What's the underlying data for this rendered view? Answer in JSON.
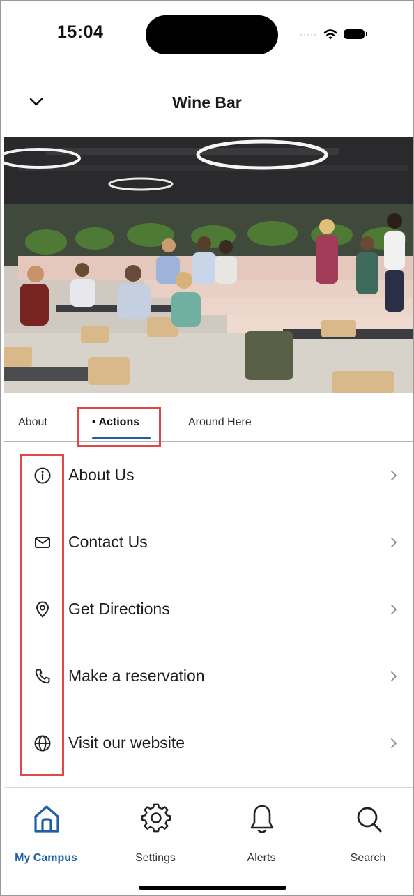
{
  "status_bar": {
    "time": "15:04"
  },
  "header": {
    "title": "Wine Bar"
  },
  "tabs": [
    {
      "label": "About"
    },
    {
      "label": "• Actions"
    },
    {
      "label": "Around Here"
    }
  ],
  "actions": [
    {
      "label": "About Us",
      "icon": "info-icon"
    },
    {
      "label": "Contact Us",
      "icon": "mail-icon"
    },
    {
      "label": "Get Directions",
      "icon": "location-pin-icon"
    },
    {
      "label": "Make a reservation",
      "icon": "phone-icon"
    },
    {
      "label": "Visit our website",
      "icon": "globe-icon"
    }
  ],
  "bottom_nav": [
    {
      "label": "My Campus",
      "icon": "home-icon",
      "active": true
    },
    {
      "label": "Settings",
      "icon": "gear-icon"
    },
    {
      "label": "Alerts",
      "icon": "bell-icon"
    },
    {
      "label": "Search",
      "icon": "search-icon"
    }
  ],
  "colors": {
    "accent": "#1f5fa8",
    "highlight": "#e04848"
  }
}
